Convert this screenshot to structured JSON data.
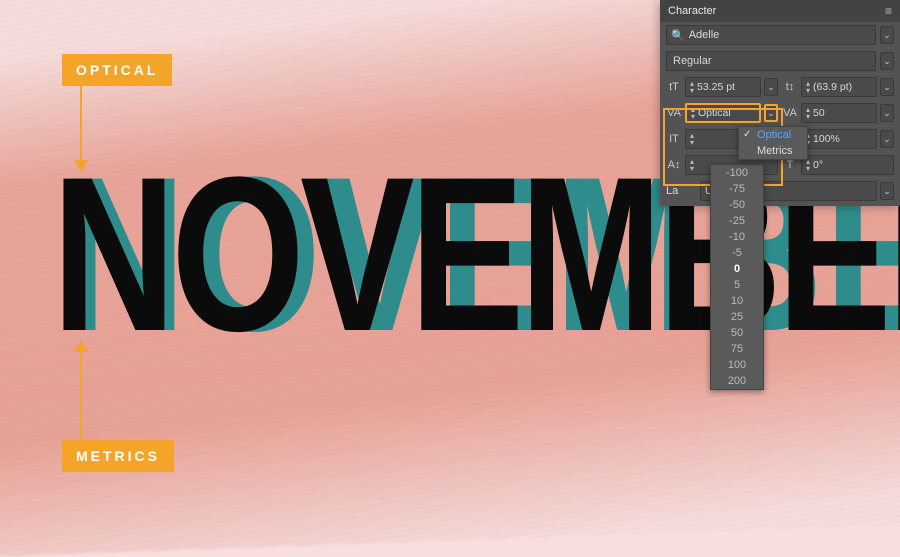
{
  "canvas": {
    "word": "NOVEMBER",
    "shadow_color": "#2f8c8c",
    "text_color": "#0b0b0b"
  },
  "annotations": {
    "optical_tag": "OPTICAL",
    "metrics_tag": "METRICS"
  },
  "panel": {
    "title": "Character",
    "font_search": "Adelle",
    "style": "Regular",
    "font_size": "53.25 pt",
    "leading": "(63.9 pt)",
    "kerning": "Optical",
    "tracking": "50",
    "vscale": "100%",
    "baseline": "0°",
    "language_label": "La",
    "language": "USA"
  },
  "kerning_options": {
    "optical": "Optical",
    "metrics": "Metrics"
  },
  "value_list": [
    "-100",
    "-75",
    "-50",
    "-25",
    "-10",
    "-5",
    "0",
    "5",
    "10",
    "25",
    "50",
    "75",
    "100",
    "200"
  ],
  "icons": {
    "fontsize": "tT",
    "leading": "t↕",
    "kerning": "VA",
    "tracking": "VA",
    "vscale": "IT",
    "hscale": "T",
    "baseline": "A↕",
    "angle": "T"
  }
}
